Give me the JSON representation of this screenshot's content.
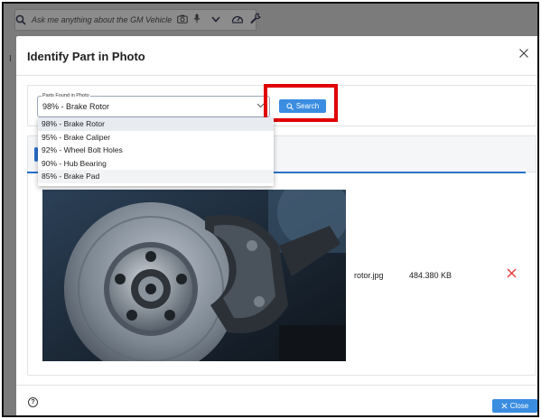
{
  "topbar": {
    "placeholder": "Ask me anything about the GM Vehicle",
    "icons": [
      "search-icon",
      "camera-icon",
      "microphone-icon",
      "chevron-down-icon",
      "dashboard-icon",
      "wrench-icon"
    ]
  },
  "modal": {
    "title": "Identify Part in Photo",
    "parts_select": {
      "legend": "Parts Found in Photo",
      "value": "98% - Brake Rotor",
      "options": [
        "98% - Brake Rotor",
        "95% - Brake Caliper",
        "92% - Wheel Bolt Holes",
        "90% - Hub Bearing",
        "85% - Brake Pad"
      ]
    },
    "search_label": "Search",
    "file": {
      "name": "rotor.jpg",
      "size": "484.380 KB"
    },
    "close_label": "Close"
  },
  "colors": {
    "accent": "#3a8de0",
    "highlight": "#e00000",
    "danger": "#e53935"
  }
}
